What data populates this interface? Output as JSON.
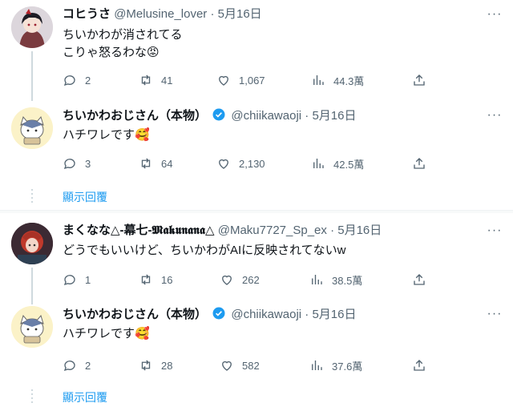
{
  "threads": [
    {
      "tweet": {
        "name": "コヒうさ",
        "handle": "@Melusine_lover",
        "dot": "·",
        "date": "5月16日",
        "lines": [
          "ちいかわが消されてる",
          "こりゃ怒るわな😡"
        ],
        "stats": {
          "reply": "2",
          "retweet": "41",
          "like": "1,067",
          "views": "44.3萬"
        }
      },
      "reply": {
        "name": "ちいかわおじさん（本物）",
        "handle": "@chiikawaoji",
        "dot": "·",
        "date": "5月16日",
        "lines": [
          "ハチワレです🥰"
        ],
        "stats": {
          "reply": "3",
          "retweet": "64",
          "like": "2,130",
          "views": "42.5萬"
        }
      },
      "show_replies": "顯示回覆"
    },
    {
      "tweet": {
        "name": "まくなな△-幕七-𝕸𝖆𝖐𝖚𝖓𝖆𝖓𝖆△",
        "handle": "@Maku7727_Sp_ex",
        "dot": "·",
        "date": "5月16日",
        "lines": [
          "どうでもいいけど、ちいかわがAIに反映されてないw"
        ],
        "stats": {
          "reply": "1",
          "retweet": "16",
          "like": "262",
          "views": "38.5萬"
        }
      },
      "reply": {
        "name": "ちいかわおじさん（本物）",
        "handle": "@chiikawaoji",
        "dot": "·",
        "date": "5月16日",
        "lines": [
          "ハチワレです🥰"
        ],
        "stats": {
          "reply": "2",
          "retweet": "28",
          "like": "582",
          "views": "37.6萬"
        }
      },
      "show_replies": "顯示回覆"
    }
  ],
  "more_label": "···",
  "colors": {
    "link": "#1d9bf0",
    "muted": "#536471",
    "verified": "#1d9bf0",
    "line": "#cfd9de"
  }
}
